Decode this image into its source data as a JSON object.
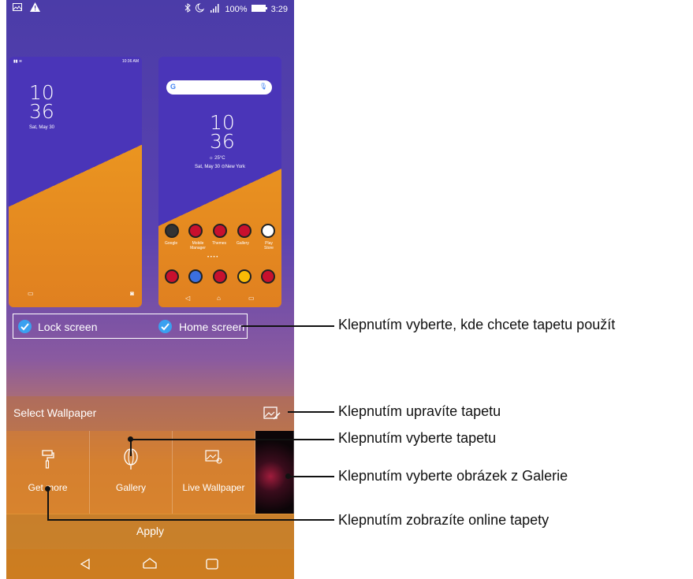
{
  "status_bar": {
    "battery": "100%",
    "time": "3:29"
  },
  "lock_preview": {
    "status_time": "10:36 AM",
    "hour": "10",
    "minute": "36",
    "date": "Sat, May 30"
  },
  "home_preview": {
    "search_letter": "G",
    "hour": "10",
    "minute": "36",
    "weather": "☼ 25°C",
    "date_location": "Sat, May 30 ⊙New York",
    "apps": [
      "Google",
      "Mobile Manager",
      "Themes",
      "Gallery",
      "Play Store"
    ]
  },
  "apply_to": {
    "lock_label": "Lock screen",
    "home_label": "Home screen"
  },
  "select_wallpaper": {
    "title": "Select Wallpaper"
  },
  "tiles": {
    "get_more": "Get more",
    "gallery": "Gallery",
    "live_wallpaper": "Live Wallpaper"
  },
  "apply": {
    "label": "Apply"
  },
  "callouts": {
    "choose_where": "Klepnutím vyberte, kde chcete tapetu použít",
    "edit": "Klepnutím upravíte tapetu",
    "choose_wallpaper": "Klepnutím vyberte tapetu",
    "choose_from_gallery": "Klepnutím vyberte obrázek z Galerie",
    "online": "Klepnutím zobrazíte online tapety"
  },
  "colors": {
    "accent_check": "#3aa0f0",
    "violet": "#4a35b8",
    "orange": "#e79a2c"
  }
}
